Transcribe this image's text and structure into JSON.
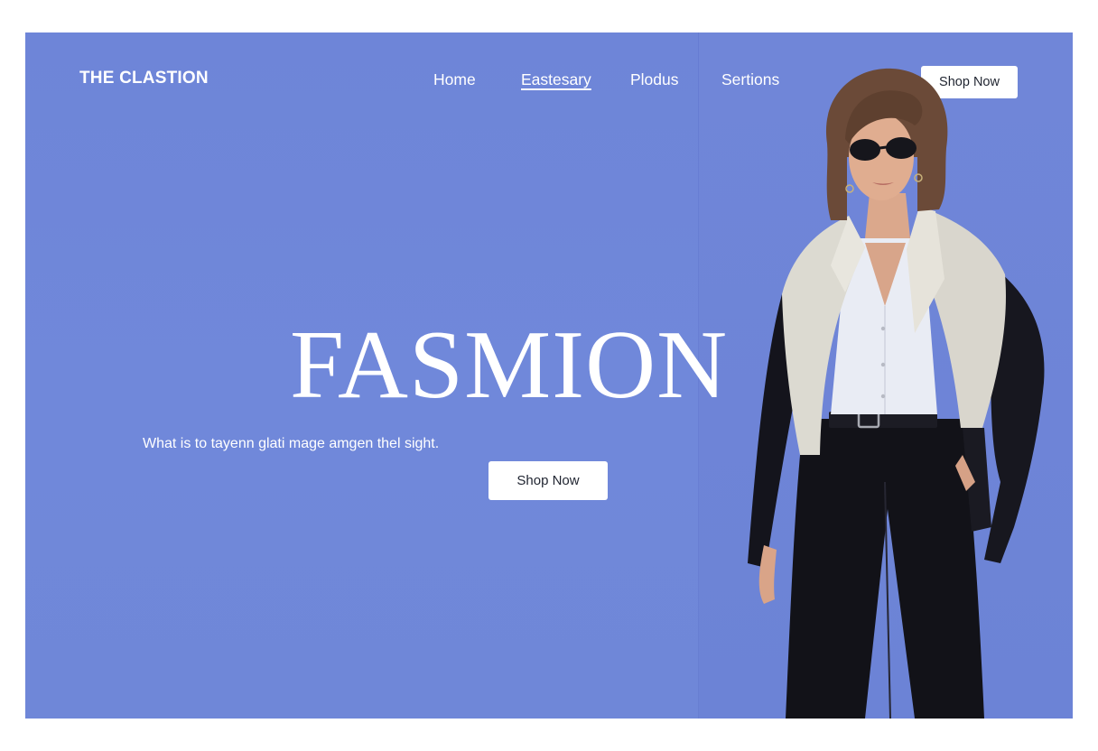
{
  "brand": {
    "name": "THE CLASTION"
  },
  "nav": {
    "items": [
      {
        "label": "Home"
      },
      {
        "label": "Eastesary"
      },
      {
        "label": "Plodus"
      },
      {
        "label": "Sertions"
      }
    ],
    "cta_label": "Shop Now"
  },
  "hero": {
    "title": "FASMION",
    "subtitle": "What is to tayenn glati mage amgen thel sight.",
    "cta_label": "Shop Now"
  },
  "model_image": {
    "icon": "fashion-model-photo"
  },
  "colors": {
    "background": "#6f86d8",
    "text": "#ffffff",
    "button_bg": "#ffffff",
    "button_text": "#1f2430"
  }
}
